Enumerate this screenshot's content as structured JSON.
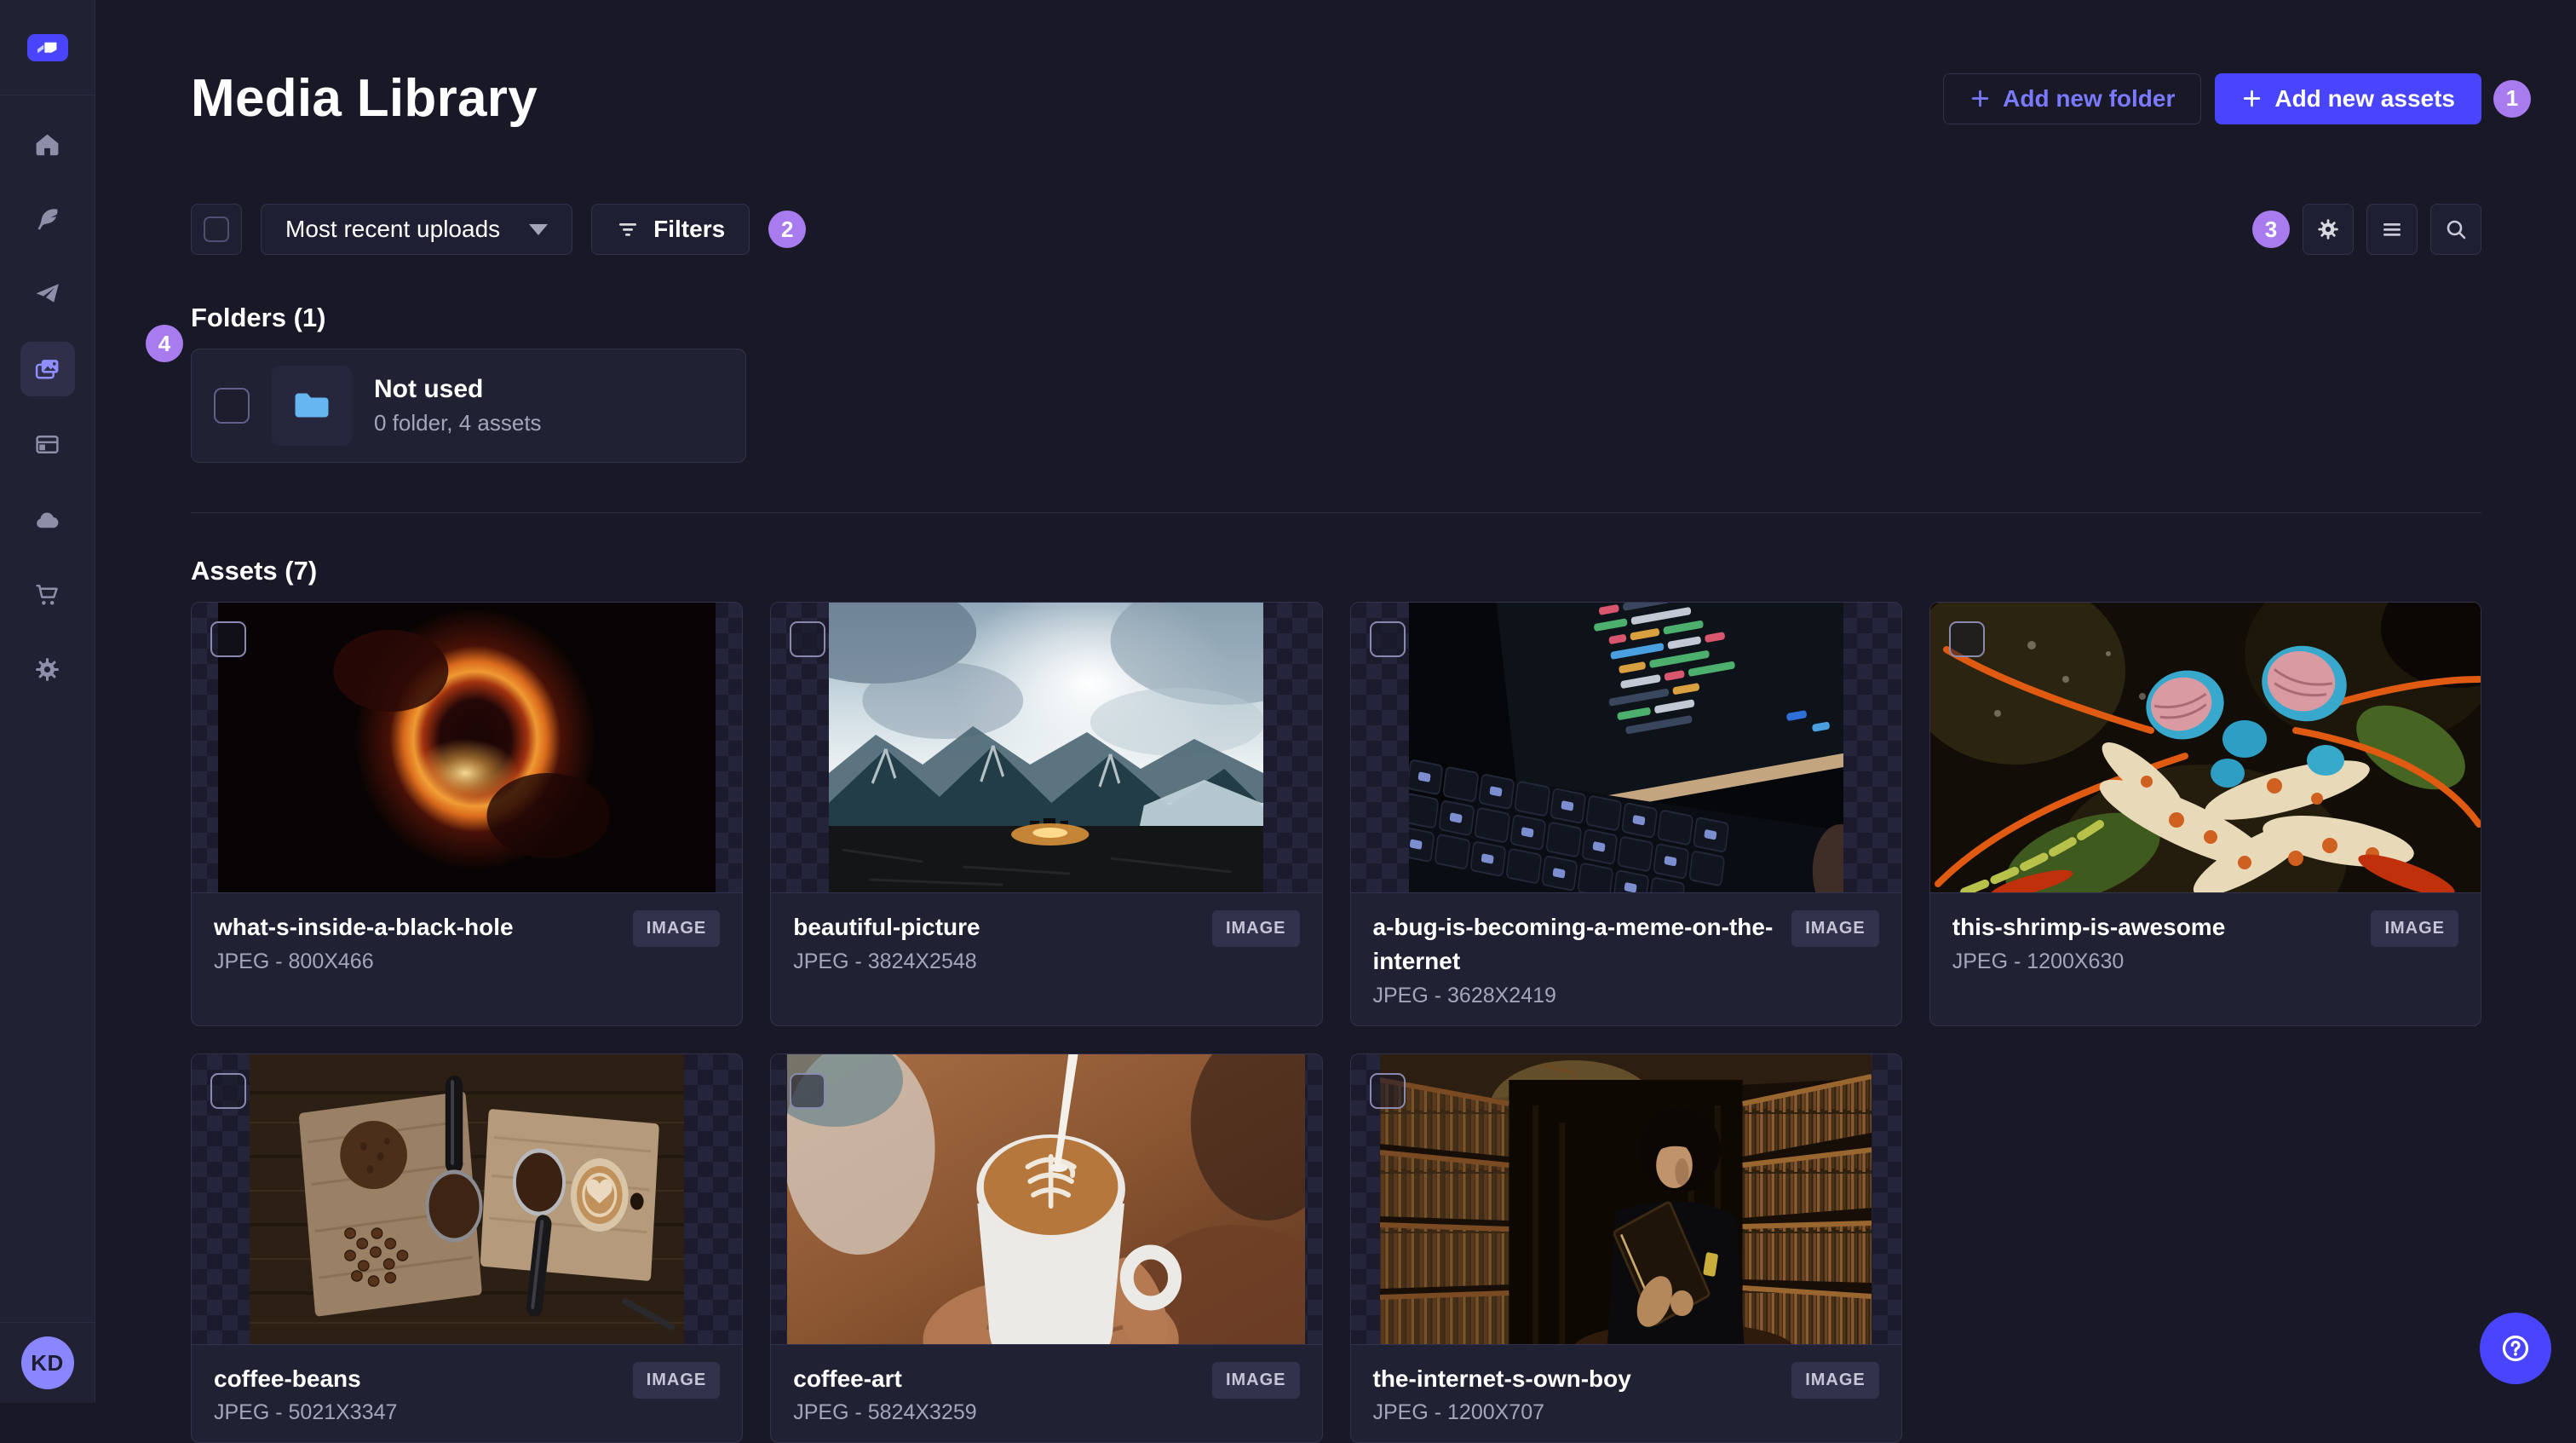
{
  "header": {
    "title": "Media Library",
    "add_folder_label": "Add new folder",
    "add_assets_label": "Add new assets"
  },
  "toolbar": {
    "sort_value": "Most recent uploads",
    "filters_label": "Filters"
  },
  "tour": {
    "step1": "1",
    "step2": "2",
    "step3": "3",
    "step4": "4"
  },
  "folders": {
    "heading": "Folders (1)",
    "items": [
      {
        "name": "Not used",
        "meta": "0 folder, 4 assets"
      }
    ]
  },
  "assets": {
    "heading": "Assets (7)",
    "items": [
      {
        "name": "what-s-inside-a-black-hole",
        "meta": "JPEG - 800X466",
        "type": "IMAGE",
        "art": "blackhole"
      },
      {
        "name": "beautiful-picture",
        "meta": "JPEG - 3824X2548",
        "type": "IMAGE",
        "art": "mountains"
      },
      {
        "name": "a-bug-is-becoming-a-meme-on-the-internet",
        "meta": "JPEG - 3628X2419",
        "type": "IMAGE",
        "art": "laptop"
      },
      {
        "name": "this-shrimp-is-awesome",
        "meta": "JPEG - 1200X630",
        "type": "IMAGE",
        "art": "shrimp"
      },
      {
        "name": "coffee-beans",
        "meta": "JPEG - 5021X3347",
        "type": "IMAGE",
        "art": "beans"
      },
      {
        "name": "coffee-art",
        "meta": "JPEG - 5824X3259",
        "type": "IMAGE",
        "art": "latte"
      },
      {
        "name": "the-internet-s-own-boy",
        "meta": "JPEG - 1200X707",
        "type": "IMAGE",
        "art": "library"
      }
    ]
  },
  "sidebar": {
    "avatar_initials": "KD"
  },
  "colors": {
    "primary": "#4945ff",
    "tour_badge": "#a87cee",
    "folder_icon": "#66b7f1",
    "page_bg": "#181826",
    "card_bg": "#212134",
    "border": "#32324d",
    "text_secondary": "#a5a5ba"
  }
}
